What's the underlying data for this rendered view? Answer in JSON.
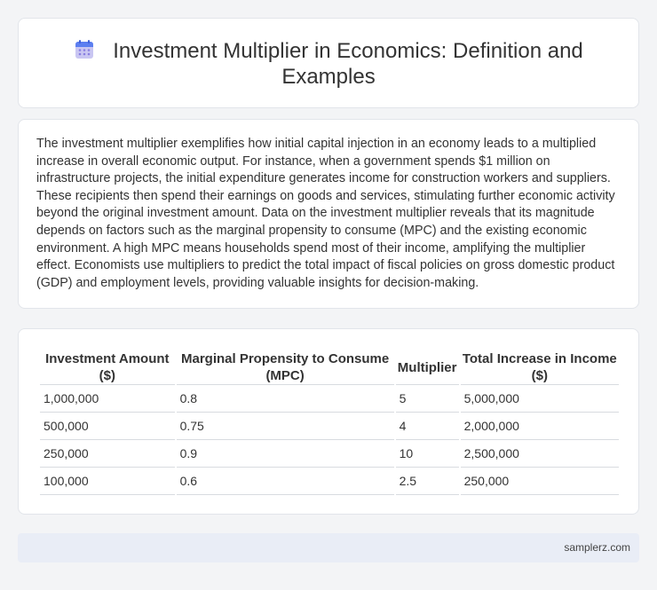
{
  "header": {
    "title": "Investment Multiplier in Economics: Definition and Examples",
    "icon": "calendar-icon"
  },
  "intro": {
    "text": "The investment multiplier exemplifies how initial capital injection in an economy leads to a multiplied increase in overall economic output. For instance, when a government spends $1 million on infrastructure projects, the initial expenditure generates income for construction workers and suppliers. These recipients then spend their earnings on goods and services, stimulating further economic activity beyond the original investment amount. Data on the investment multiplier reveals that its magnitude depends on factors such as the marginal propensity to consume (MPC) and the existing economic environment. A high MPC means households spend most of their income, amplifying the multiplier effect. Economists use multipliers to predict the total impact of fiscal policies on gross domestic product (GDP) and employment levels, providing valuable insights for decision-making."
  },
  "table": {
    "headers": [
      "Investment Amount ($)",
      "Marginal Propensity to Consume (MPC)",
      "Multiplier",
      "Total Increase in Income ($)"
    ],
    "rows": [
      [
        "1,000,000",
        "0.8",
        "5",
        "5,000,000"
      ],
      [
        "500,000",
        "0.75",
        "4",
        "2,000,000"
      ],
      [
        "250,000",
        "0.9",
        "10",
        "2,500,000"
      ],
      [
        "100,000",
        "0.6",
        "2.5",
        "250,000"
      ]
    ]
  },
  "footer": {
    "site": "samplerz.com"
  }
}
